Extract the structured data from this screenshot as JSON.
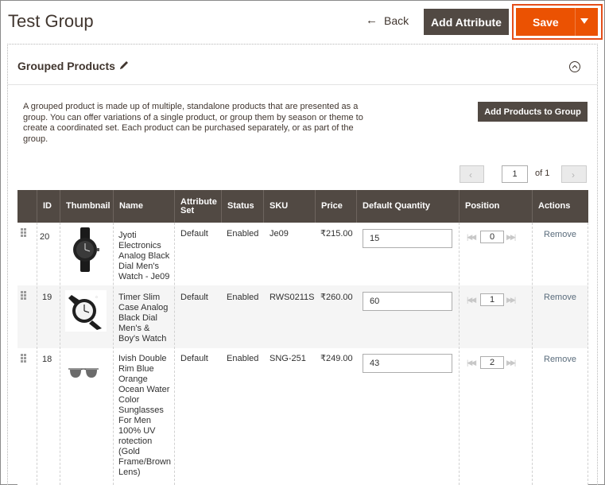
{
  "header": {
    "title": "Test Group",
    "back_label": "Back",
    "add_attribute_label": "Add Attribute",
    "save_label": "Save"
  },
  "section": {
    "title": "Grouped Products",
    "description": "A grouped product is made up of multiple, standalone products that are presented as a group. You can offer variations of a single product, or group them by season or theme to create a coordinated set. Each product can be purchased separately, or as part of the group.",
    "add_products_label": "Add Products to Group"
  },
  "pager": {
    "current_page": "1",
    "of_label": "of 1"
  },
  "grid": {
    "columns": [
      "ID",
      "Thumbnail",
      "Name",
      "Attribute Set",
      "Status",
      "SKU",
      "Price",
      "Default Quantity",
      "Position",
      "Actions"
    ],
    "rows": [
      {
        "id": "20",
        "name": "Jyoti Electronics Analog Black Dial Men's Watch - Je09",
        "attribute_set": "Default",
        "status": "Enabled",
        "sku": "Je09",
        "price": "₹215.00",
        "qty": "15",
        "position": "0",
        "action": "Remove"
      },
      {
        "id": "19",
        "name": "Timer Slim Case Analog Black Dial Men's & Boy's Watch",
        "attribute_set": "Default",
        "status": "Enabled",
        "sku": "RWS0211S",
        "price": "₹260.00",
        "qty": "60",
        "position": "1",
        "action": "Remove"
      },
      {
        "id": "18",
        "name": "Ivish Double Rim Blue Orange Ocean Water Color Sunglasses For Men 100% UV rotection (Gold Frame/Brown Lens)",
        "attribute_set": "Default",
        "status": "Enabled",
        "sku": "SNG-251",
        "price": "₹249.00",
        "qty": "43",
        "position": "2",
        "action": "Remove"
      }
    ]
  },
  "icons": {
    "back": "arrow-left-icon",
    "save_menu": "caret-down-icon",
    "edit": "pencil-icon",
    "collapse": "chevron-up-circle-icon",
    "drag": "drag-handle-icon"
  },
  "colors": {
    "accent": "#eb5202",
    "dark_button": "#514943",
    "header_bg": "#514943"
  }
}
